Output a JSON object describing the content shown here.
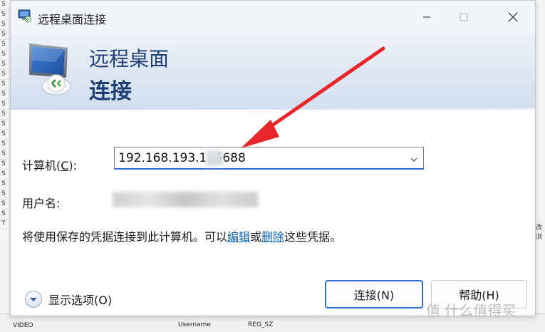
{
  "window": {
    "title": "远程桌面连接",
    "minimize_icon": "minimize-icon",
    "maximize_icon": "maximize-icon",
    "close_icon": "close-icon"
  },
  "banner": {
    "line1": "远程桌面",
    "line2": "连接",
    "icon": "remote-desktop-monitor-icon"
  },
  "form": {
    "computer_label": "计算机(",
    "computer_key": "C",
    "computer_label_end": "):",
    "computer_value": "192.168.193.1  :6688",
    "computer_dropdown_icon": "chevron-down-icon",
    "user_label": "用户名:"
  },
  "info": {
    "prefix": "将使用保存的凭据连接到此计算机。可以",
    "edit_link": "编辑",
    "middle": "或",
    "delete_link": "删除",
    "suffix": "这些凭据。"
  },
  "footer": {
    "options_label": "显示选项(O)",
    "options_icon": "expand-options-icon",
    "connect_button": "连接(N)",
    "help_button": "帮助(H)"
  },
  "background": {
    "right_fragment": "改浏",
    "bottom_row_col1": "VIDEO",
    "bottom_row_col2": "Username",
    "bottom_row_col3": "REG_SZ",
    "watermark": "值 什么值得买"
  },
  "colors": {
    "accent": "#2f6fce",
    "banner_text": "#1f3f73",
    "link": "#0a63b4",
    "annotation_arrow": "#e8262b"
  }
}
